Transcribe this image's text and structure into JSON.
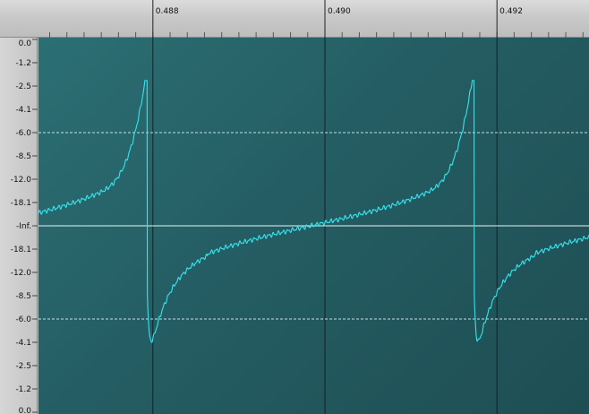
{
  "time_ruler": {
    "labels": [
      "0.488",
      "0.490",
      "0.492"
    ],
    "values": [
      0.488,
      0.49,
      0.492
    ]
  },
  "amplitude_ruler": {
    "labels": [
      "0.0",
      "-1.2",
      "-2.5",
      "-4.1",
      "-6.0",
      "-8.5",
      "-12.0",
      "-18.1",
      "-Inf.",
      "-18.1",
      "-12.0",
      "-8.5",
      "-6.0",
      "-4.1",
      "-2.5",
      "-1.2",
      "0.0"
    ],
    "linear_levels": [
      1.0,
      0.875,
      0.75,
      0.625,
      0.5,
      0.375,
      0.25,
      0.125,
      0.0,
      -0.125,
      -0.25,
      -0.375,
      -0.5,
      -0.625,
      -0.75,
      -0.875,
      -1.0
    ]
  },
  "guides": {
    "half_level_db": "-6.0",
    "half_level_linear": 0.5
  },
  "colors": {
    "waveform": "#37e4ec",
    "background": "#245d63",
    "centerline": "#e8f4f4",
    "guide": "#d8eeee",
    "marker": "#0b1a1c"
  },
  "view": {
    "time_start": 0.48667,
    "time_end": 0.49307,
    "amplitude_range": [
      -1.0,
      1.0
    ]
  }
}
